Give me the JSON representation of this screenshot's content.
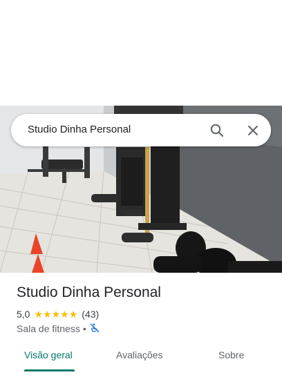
{
  "search": {
    "query": "Studio Dinha Personal"
  },
  "place": {
    "name": "Studio Dinha Personal",
    "rating": "5,0",
    "stars": 5,
    "review_count": "(43)",
    "category": "Sala de fitness",
    "separator": "•",
    "wheelchair_icon": "no-wheelchair-access-icon"
  },
  "tabs": [
    {
      "label": "Visão geral",
      "active": true
    },
    {
      "label": "Avaliações",
      "active": false
    },
    {
      "label": "Sobre",
      "active": false
    }
  ],
  "colors": {
    "accent": "#00796b",
    "star": "#fbbc04",
    "access_icon": "#1a73e8"
  },
  "icons": {
    "search": "search-icon",
    "close": "close-icon"
  }
}
